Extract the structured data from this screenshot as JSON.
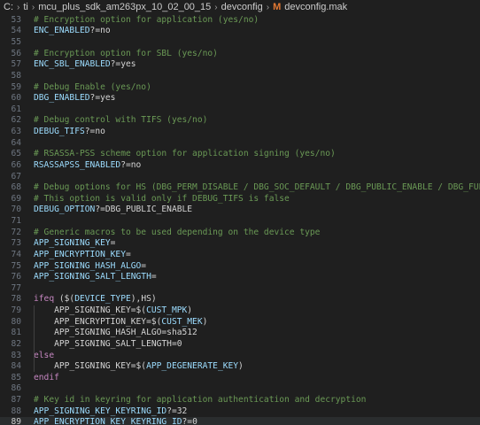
{
  "breadcrumb": {
    "parts": [
      "C:",
      "ti",
      "mcu_plus_sdk_am263px_10_02_00_15",
      "devconfig"
    ],
    "file_icon": "M",
    "file_name": "devconfig.mak"
  },
  "lines": [
    {
      "n": "53",
      "segs": [
        {
          "t": "# Encryption option for application (yes/no)",
          "c": "c-comment"
        }
      ]
    },
    {
      "n": "54",
      "segs": [
        {
          "t": "ENC_ENABLED",
          "c": "c-var"
        },
        {
          "t": "?=no",
          "c": "c-plain"
        }
      ]
    },
    {
      "n": "55",
      "segs": []
    },
    {
      "n": "56",
      "segs": [
        {
          "t": "# Encryption option for SBL (yes/no)",
          "c": "c-comment"
        }
      ]
    },
    {
      "n": "57",
      "segs": [
        {
          "t": "ENC_SBL_ENABLED",
          "c": "c-var"
        },
        {
          "t": "?=yes",
          "c": "c-plain"
        }
      ]
    },
    {
      "n": "58",
      "segs": []
    },
    {
      "n": "59",
      "segs": [
        {
          "t": "# Debug Enable (yes/no)",
          "c": "c-comment"
        }
      ]
    },
    {
      "n": "60",
      "segs": [
        {
          "t": "DBG_ENABLED",
          "c": "c-var"
        },
        {
          "t": "?=yes",
          "c": "c-plain"
        }
      ]
    },
    {
      "n": "61",
      "segs": []
    },
    {
      "n": "62",
      "segs": [
        {
          "t": "# Debug control with TIFS (yes/no)",
          "c": "c-comment"
        }
      ]
    },
    {
      "n": "63",
      "segs": [
        {
          "t": "DEBUG_TIFS",
          "c": "c-var"
        },
        {
          "t": "?=no",
          "c": "c-plain"
        }
      ]
    },
    {
      "n": "64",
      "segs": []
    },
    {
      "n": "65",
      "segs": [
        {
          "t": "# RSASSA-PSS scheme option for application signing (yes/no)",
          "c": "c-comment"
        }
      ]
    },
    {
      "n": "66",
      "segs": [
        {
          "t": "RSASSAPSS_ENABLED",
          "c": "c-var"
        },
        {
          "t": "?=no",
          "c": "c-plain"
        }
      ]
    },
    {
      "n": "67",
      "segs": []
    },
    {
      "n": "68",
      "segs": [
        {
          "t": "# Debug options for HS (DBG_PERM_DISABLE / DBG_SOC_DEFAULT / DBG_PUBLIC_ENABLE / DBG_FULL_ENABLE)",
          "c": "c-comment"
        }
      ]
    },
    {
      "n": "69",
      "segs": [
        {
          "t": "# This option is valid only if DEBUG_TIFS is false",
          "c": "c-comment"
        }
      ]
    },
    {
      "n": "70",
      "segs": [
        {
          "t": "DEBUG_OPTION",
          "c": "c-var"
        },
        {
          "t": "?=DBG_PUBLIC_ENABLE",
          "c": "c-plain"
        }
      ]
    },
    {
      "n": "71",
      "segs": []
    },
    {
      "n": "72",
      "segs": [
        {
          "t": "# Generic macros to be used depending on the device type",
          "c": "c-comment"
        }
      ]
    },
    {
      "n": "73",
      "segs": [
        {
          "t": "APP_SIGNING_KEY",
          "c": "c-var"
        },
        {
          "t": "=",
          "c": "c-plain"
        }
      ]
    },
    {
      "n": "74",
      "segs": [
        {
          "t": "APP_ENCRYPTION_KEY",
          "c": "c-var"
        },
        {
          "t": "=",
          "c": "c-plain"
        }
      ]
    },
    {
      "n": "75",
      "segs": [
        {
          "t": "APP_SIGNING_HASH_ALGO",
          "c": "c-var"
        },
        {
          "t": "=",
          "c": "c-plain"
        }
      ]
    },
    {
      "n": "76",
      "segs": [
        {
          "t": "APP_SIGNING_SALT_LENGTH",
          "c": "c-var"
        },
        {
          "t": "=",
          "c": "c-plain"
        }
      ]
    },
    {
      "n": "77",
      "segs": []
    },
    {
      "n": "78",
      "segs": [
        {
          "t": "ifeq",
          "c": "c-kw"
        },
        {
          "t": " ($(",
          "c": "c-plain"
        },
        {
          "t": "DEVICE_TYPE",
          "c": "c-var"
        },
        {
          "t": "),HS)",
          "c": "c-plain"
        }
      ]
    },
    {
      "n": "79",
      "segs": [
        {
          "t": "    APP_SIGNING_KEY",
          "c": "c-plain"
        },
        {
          "t": "=$(",
          "c": "c-plain"
        },
        {
          "t": "CUST_MPK",
          "c": "c-var"
        },
        {
          "t": ")",
          "c": "c-plain"
        }
      ]
    },
    {
      "n": "80",
      "segs": [
        {
          "t": "    APP_ENCRYPTION_KEY",
          "c": "c-plain"
        },
        {
          "t": "=$(",
          "c": "c-plain"
        },
        {
          "t": "CUST_MEK",
          "c": "c-var"
        },
        {
          "t": ")",
          "c": "c-plain"
        }
      ]
    },
    {
      "n": "81",
      "segs": [
        {
          "t": "    APP_SIGNING_HASH_ALGO",
          "c": "c-plain"
        },
        {
          "t": "=sha512",
          "c": "c-plain"
        }
      ]
    },
    {
      "n": "82",
      "segs": [
        {
          "t": "    APP_SIGNING_SALT_LENGTH",
          "c": "c-plain"
        },
        {
          "t": "=0",
          "c": "c-plain"
        }
      ]
    },
    {
      "n": "83",
      "segs": [
        {
          "t": "else",
          "c": "c-kw"
        }
      ]
    },
    {
      "n": "84",
      "segs": [
        {
          "t": "    APP_SIGNING_KEY",
          "c": "c-plain"
        },
        {
          "t": "=$(",
          "c": "c-plain"
        },
        {
          "t": "APP_DEGENERATE_KEY",
          "c": "c-var"
        },
        {
          "t": ")",
          "c": "c-plain"
        }
      ]
    },
    {
      "n": "85",
      "segs": [
        {
          "t": "endif",
          "c": "c-kw"
        }
      ]
    },
    {
      "n": "86",
      "segs": []
    },
    {
      "n": "87",
      "segs": [
        {
          "t": "# Key id in keyring for application authentication and decryption",
          "c": "c-comment"
        }
      ]
    },
    {
      "n": "88",
      "segs": [
        {
          "t": "APP_SIGNING_KEY_KEYRING_ID",
          "c": "c-var"
        },
        {
          "t": "?=32",
          "c": "c-plain"
        }
      ]
    },
    {
      "n": "89",
      "segs": [
        {
          "t": "APP_ENCRYPTION_KEY_KEYRING_ID",
          "c": "c-var"
        },
        {
          "t": "?=0",
          "c": "c-plain"
        }
      ],
      "current": true
    }
  ]
}
